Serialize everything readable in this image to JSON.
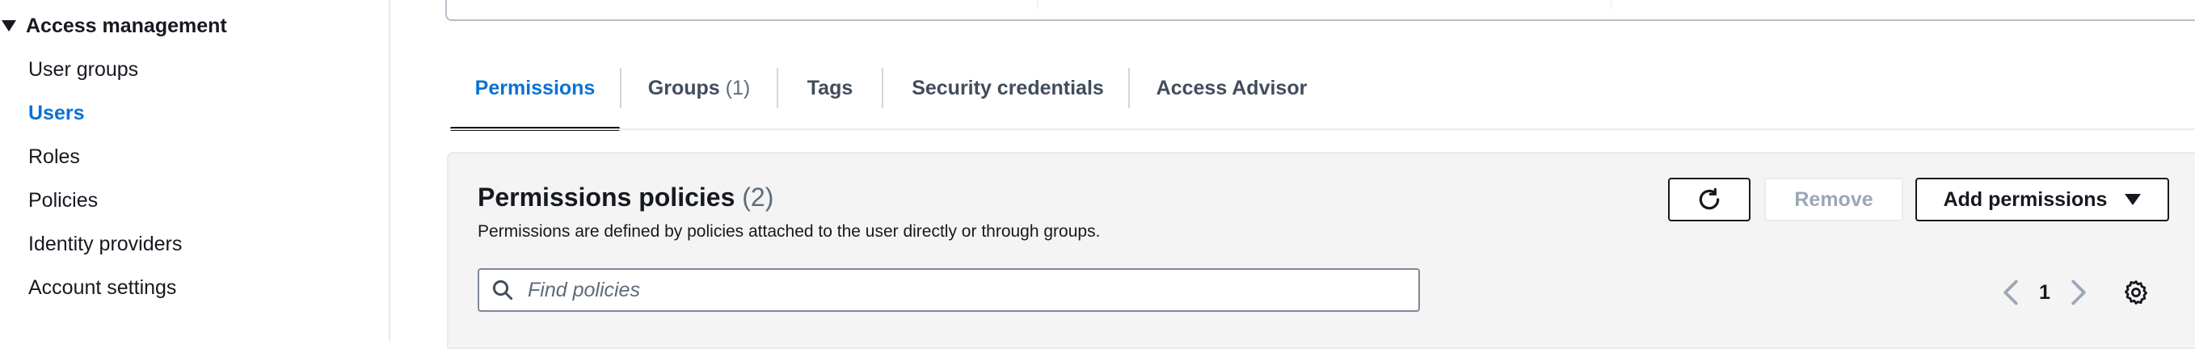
{
  "sidebar": {
    "section": "Access management",
    "items": [
      {
        "label": "User groups"
      },
      {
        "label": "Users"
      },
      {
        "label": "Roles"
      },
      {
        "label": "Policies"
      },
      {
        "label": "Identity providers"
      },
      {
        "label": "Account settings"
      }
    ],
    "active_item": "Users"
  },
  "tabs": [
    {
      "label": "Permissions"
    },
    {
      "label": "Groups",
      "count": "(1)"
    },
    {
      "label": "Tags"
    },
    {
      "label": "Security credentials"
    },
    {
      "label": "Access Advisor"
    }
  ],
  "active_tab": "Permissions",
  "permissions": {
    "title": "Permissions policies",
    "count": "(2)",
    "description": "Permissions are defined by policies attached to the user directly or through groups.",
    "remove_label": "Remove",
    "add_label": "Add permissions",
    "search_placeholder": "Find policies",
    "search_value": "",
    "page": "1"
  },
  "colors": {
    "accent": "#0972d3",
    "text": "#16191f",
    "disabled": "#9ba7b6",
    "panel_bg": "#f4f4f4"
  },
  "icons": [
    "caret-down-icon",
    "refresh-icon",
    "search-icon",
    "chevron-left-icon",
    "chevron-right-icon",
    "settings-gear-icon"
  ]
}
